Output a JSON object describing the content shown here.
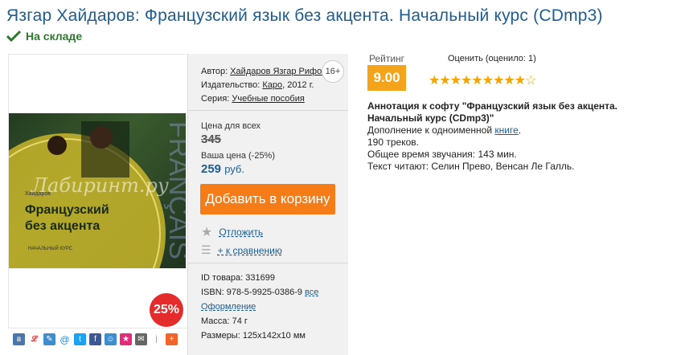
{
  "title": "Язгар Хайдаров: Французский язык без акцента. Начальный курс (CDmp3)",
  "stock": "На складе",
  "cover": {
    "author_small": "Хайдаров",
    "title_line1": "Французский",
    "title_line2": "без акцента",
    "subtitle": "НАЧАЛЬНЫЙ КУРС",
    "side_text": "FRANÇAIS",
    "watermark": "Лабиринт.ру"
  },
  "sale_badge": "25%",
  "share_icons": [
    "vk-icon",
    "mm-icon",
    "lj-icon",
    "mail-icon",
    "twitter-icon",
    "facebook-icon",
    "ok-icon",
    "bookmark-icon",
    "email-icon",
    "plus-icon"
  ],
  "meta": {
    "author_label": "Автор:",
    "author_value": "Хайдаров Язгар Рифов",
    "publisher_label": "Издательство:",
    "publisher_value": "Каро",
    "year": ", 2012 г.",
    "series_label": "Серия:",
    "series_value": "Учебные пособия",
    "age": "16+"
  },
  "price": {
    "all_label": "Цена для всех",
    "old": "345",
    "your_label": "Ваша цена (-25%)",
    "new": "259",
    "currency": "руб."
  },
  "cart_button": "Добавить в корзину",
  "postpone": "Отложить",
  "compare": "+ к сравнению",
  "specs": {
    "id": "ID товара: 331699",
    "isbn": "ISBN: 978-5-9925-0386-9",
    "isbn_all": "все",
    "design": "Оформление",
    "mass": "Масса: 74 г",
    "size": "Размеры: 125x142x10 мм"
  },
  "rating": {
    "label": "Рейтинг",
    "value": "9.00",
    "rate_label": "Оценить (оценило: 1)",
    "stars": 9,
    "stars_max": 10,
    "star_color": "#f4a300"
  },
  "annotation": {
    "title": "Аннотация к софту \"Французский язык без акцента. Начальный курс (CDmp3)\"",
    "line1_prefix": "Дополнение к одноименной",
    "line1_link": "книге",
    "line1_suffix": ".",
    "line2": "190 треков.",
    "line3": "Общее время звучания: 143 мин.",
    "line4": "Текст читают: Селин Прево, Венсан Ле Галль."
  }
}
